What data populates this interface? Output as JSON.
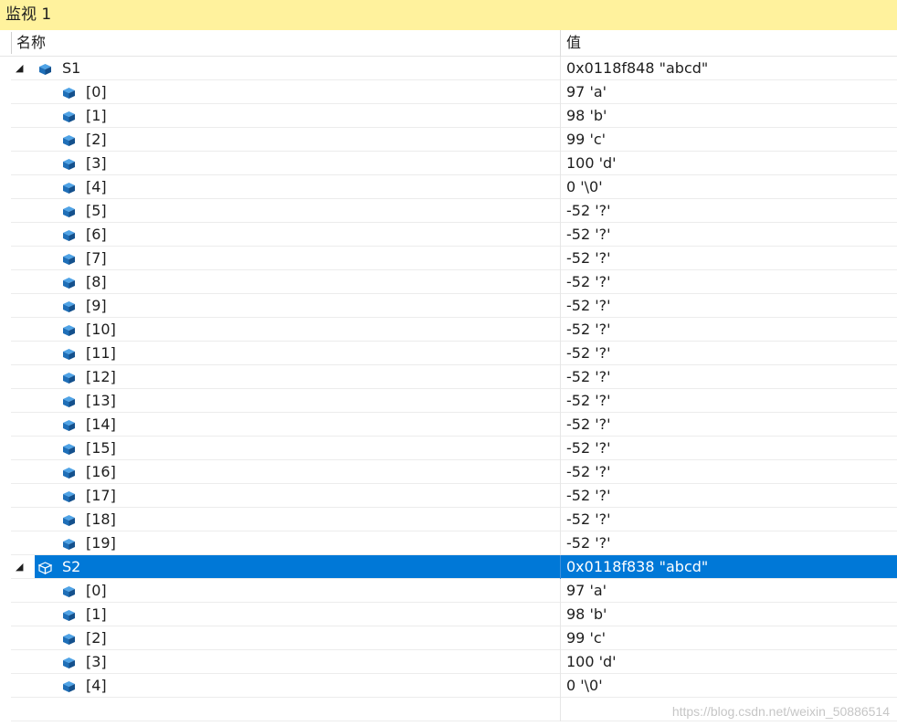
{
  "window": {
    "title": "监视 1"
  },
  "columns": {
    "name": "名称",
    "value": "值"
  },
  "colors": {
    "selection": "#0078d7",
    "title_bar": "#fff29d",
    "icon_blue": "#1f6fb8"
  },
  "variables": [
    {
      "name": "S1",
      "value": "0x0118f848 \"abcd\"",
      "expanded": true,
      "selected": false,
      "children": [
        {
          "name": "[0]",
          "value": "97 'a'"
        },
        {
          "name": "[1]",
          "value": "98 'b'"
        },
        {
          "name": "[2]",
          "value": "99 'c'"
        },
        {
          "name": "[3]",
          "value": "100 'd'"
        },
        {
          "name": "[4]",
          "value": "0 '\\0'"
        },
        {
          "name": "[5]",
          "value": "-52 '?'"
        },
        {
          "name": "[6]",
          "value": "-52 '?'"
        },
        {
          "name": "[7]",
          "value": "-52 '?'"
        },
        {
          "name": "[8]",
          "value": "-52 '?'"
        },
        {
          "name": "[9]",
          "value": "-52 '?'"
        },
        {
          "name": "[10]",
          "value": "-52 '?'"
        },
        {
          "name": "[11]",
          "value": "-52 '?'"
        },
        {
          "name": "[12]",
          "value": "-52 '?'"
        },
        {
          "name": "[13]",
          "value": "-52 '?'"
        },
        {
          "name": "[14]",
          "value": "-52 '?'"
        },
        {
          "name": "[15]",
          "value": "-52 '?'"
        },
        {
          "name": "[16]",
          "value": "-52 '?'"
        },
        {
          "name": "[17]",
          "value": "-52 '?'"
        },
        {
          "name": "[18]",
          "value": "-52 '?'"
        },
        {
          "name": "[19]",
          "value": "-52 '?'"
        }
      ]
    },
    {
      "name": "S2",
      "value": "0x0118f838 \"abcd\"",
      "expanded": true,
      "selected": true,
      "children": [
        {
          "name": "[0]",
          "value": "97 'a'"
        },
        {
          "name": "[1]",
          "value": "98 'b'"
        },
        {
          "name": "[2]",
          "value": "99 'c'"
        },
        {
          "name": "[3]",
          "value": "100 'd'"
        },
        {
          "name": "[4]",
          "value": "0 '\\0'"
        }
      ]
    }
  ],
  "watermark": "https://blog.csdn.net/weixin_50886514"
}
